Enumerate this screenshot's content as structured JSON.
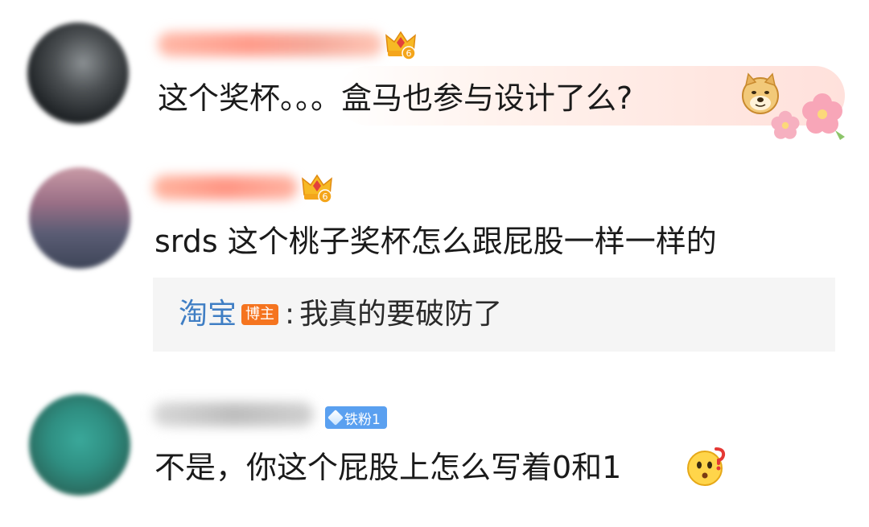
{
  "comments": [
    {
      "text": "这个奖杯。。。盒马也参与设计了么?",
      "crown_level": "6",
      "emoji": "doge-icon"
    },
    {
      "text": "srds 这个桃子奖杯怎么跟屁股一样一样的",
      "crown_level": "6",
      "reply": {
        "author": "淘宝",
        "badge": "博主",
        "separator": ":",
        "text": "我真的要破防了"
      }
    },
    {
      "text": "不是，你这个屁股上怎么写着0和1",
      "fan_badge": "铁粉1",
      "emoji": "thinking-face-icon"
    }
  ],
  "colors": {
    "reply_author": "#3f7ec4",
    "blogger_badge": "#f5741f",
    "fan_badge": "#5aa0f0"
  }
}
